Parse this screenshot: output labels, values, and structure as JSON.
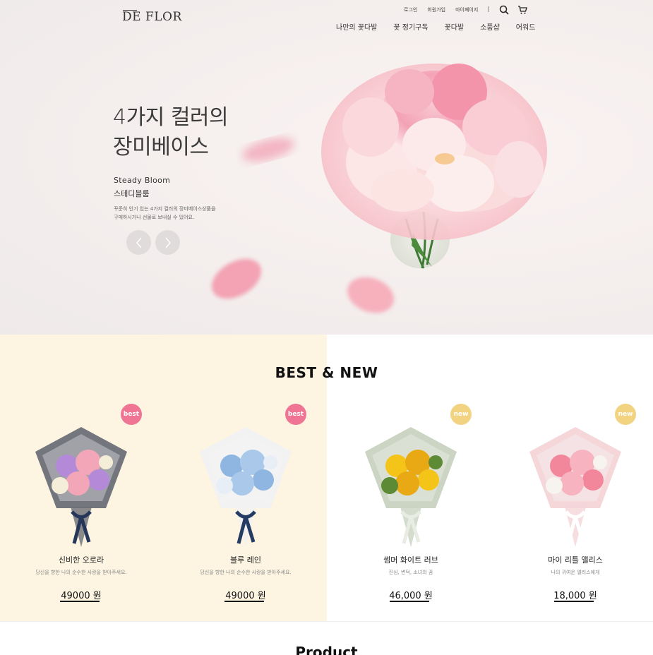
{
  "header": {
    "logo": "DE FLOR",
    "util_links": [
      "로그인",
      "회원가입",
      "마이페이지"
    ],
    "util_sep": "|",
    "icons": {
      "search": "search-icon",
      "cart": "cart-icon"
    },
    "nav": [
      "나만의 꽃다발",
      "꽃 정기구독",
      "꽃다발",
      "소품샵",
      "어워드"
    ]
  },
  "hero": {
    "title_line1": "4가지 컬러의",
    "title_line2": "장미베이스",
    "sub_en": "Steady Bloom",
    "sub_ko": "스테디블룸",
    "desc_line1": "꾸준히 인기 있는 4가지 컬러의 장미베이스상품을",
    "desc_line2": "구매하시거나 선물로 보내실 수 있어요.",
    "prev_icon": "chevron-left-icon",
    "next_icon": "chevron-right-icon"
  },
  "best_new": {
    "title": "BEST & NEW",
    "cards": [
      {
        "badge": "best",
        "name": "신비한 오로라",
        "desc": "당신을 향한 나의 순수한 사랑을 받아주세요.",
        "price": "49000 원",
        "colors": {
          "wrap": "#6d6f78",
          "flower1": "#b48ad8",
          "flower2": "#f2a6b8",
          "flower3": "#f4eed8",
          "ribbon": "#26375a"
        }
      },
      {
        "badge": "best",
        "name": "블루 레인",
        "desc": "당신을 향한 나의 순수한 사랑을 받아주세요.",
        "price": "49000 원",
        "colors": {
          "wrap": "#f1f1f3",
          "flower1": "#8fb6e0",
          "flower2": "#a9c8ea",
          "flower3": "#e8eef6",
          "ribbon": "#243b64"
        }
      },
      {
        "badge": "new",
        "name": "썸머 화이트 러브",
        "desc": "진심, 변덕, 소녀의 꿈",
        "price": "46,000 원",
        "colors": {
          "wrap": "#c9d3c0",
          "flower1": "#f4c418",
          "flower2": "#e8a914",
          "flower3": "#5c8a35",
          "ribbon": "#e8ece2"
        }
      },
      {
        "badge": "new",
        "name": "마이 리틀 앨리스",
        "desc": "나의 귀여운 앨리스에게",
        "price": "18,000 원",
        "colors": {
          "wrap": "#f4d5d8",
          "flower1": "#f2879b",
          "flower2": "#f7b3c0",
          "flower3": "#f7f3ef",
          "ribbon": "#ffffff"
        }
      }
    ]
  },
  "product": {
    "title": "Product"
  }
}
